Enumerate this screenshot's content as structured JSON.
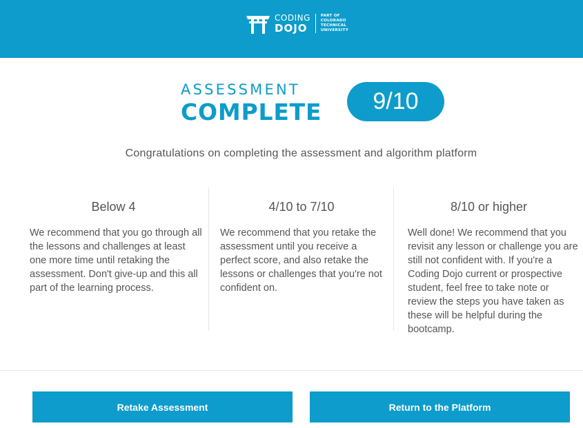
{
  "header": {
    "brand_line1": "CODING",
    "brand_line2": "DOJO",
    "affiliation": [
      "PART OF",
      "COLORADO",
      "TECHNICAL",
      "UNIVERSITY"
    ],
    "logo_icon": "torii-gate-icon"
  },
  "result": {
    "title_small": "ASSESSMENT",
    "title_big": "COMPLETE",
    "score": "9/10"
  },
  "congrats": "Congratulations on completing the assessment and algorithm platform",
  "columns": [
    {
      "heading": "Below 4",
      "body": "We recommend that you go through all the lessons and challenges at least one more time until retaking the assessment. Don't give-up and this all part of the learning process."
    },
    {
      "heading": "4/10 to 7/10",
      "body": "We recommend that you retake the assessment until you receive a perfect score, and also retake the lessons or challenges that you're not confident on."
    },
    {
      "heading": "8/10 or higher",
      "body": "Well done! We recommend that you revisit any lesson or challenge you are still not confident with. If you're a Coding Dojo current or prospective student, feel free to take note or review the steps you have taken as these will be helpful during the bootcamp."
    }
  ],
  "buttons": {
    "retake": "Retake Assessment",
    "return": "Return to the Platform"
  },
  "colors": {
    "brand": "#0d9ccb",
    "text": "#555555"
  }
}
